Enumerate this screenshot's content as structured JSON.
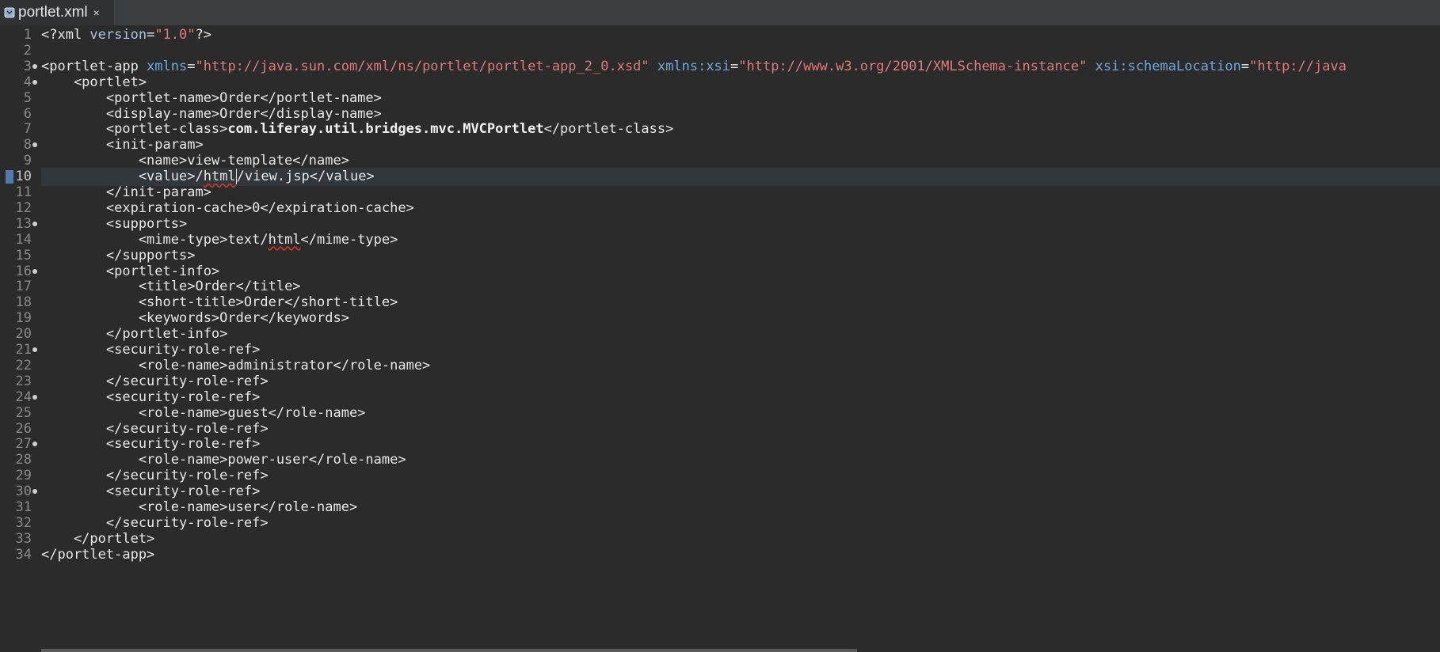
{
  "tab": {
    "title": "portlet.xml",
    "close": "×"
  },
  "editor": {
    "current_line": 10,
    "lines": [
      {
        "n": "1",
        "fold": false,
        "tokens": [
          {
            "t": "<?xml ",
            "c": "tag"
          },
          {
            "t": "version",
            "c": "decl"
          },
          {
            "t": "=",
            "c": "tag"
          },
          {
            "t": "\"1.0\"",
            "c": "str"
          },
          {
            "t": "?>",
            "c": "tag"
          }
        ]
      },
      {
        "n": "2",
        "fold": false,
        "tokens": []
      },
      {
        "n": "3",
        "fold": true,
        "tokens": [
          {
            "t": "<portlet-app ",
            "c": "tag"
          },
          {
            "t": "xmlns",
            "c": "attr"
          },
          {
            "t": "=",
            "c": "tag"
          },
          {
            "t": "\"http://java.sun.com/xml/ns/portlet/portlet-app_2_0.xsd\"",
            "c": "str"
          },
          {
            "t": " ",
            "c": "tag"
          },
          {
            "t": "xmlns:xsi",
            "c": "attr"
          },
          {
            "t": "=",
            "c": "tag"
          },
          {
            "t": "\"http://www.w3.org/2001/XMLSchema-instance\"",
            "c": "str"
          },
          {
            "t": " ",
            "c": "tag"
          },
          {
            "t": "xsi:schemaLocation",
            "c": "attr"
          },
          {
            "t": "=",
            "c": "tag"
          },
          {
            "t": "\"http://java",
            "c": "str"
          }
        ]
      },
      {
        "n": "4",
        "fold": true,
        "tokens": [
          {
            "t": "    <portlet>",
            "c": "tag"
          }
        ]
      },
      {
        "n": "5",
        "fold": false,
        "tokens": [
          {
            "t": "        <portlet-name>",
            "c": "tag"
          },
          {
            "t": "Order",
            "c": "txt"
          },
          {
            "t": "</portlet-name>",
            "c": "tag"
          }
        ]
      },
      {
        "n": "6",
        "fold": false,
        "tokens": [
          {
            "t": "        <display-name>",
            "c": "tag"
          },
          {
            "t": "Order",
            "c": "txt"
          },
          {
            "t": "</display-name>",
            "c": "tag"
          }
        ]
      },
      {
        "n": "7",
        "fold": false,
        "tokens": [
          {
            "t": "        <portlet-class>",
            "c": "tag"
          },
          {
            "t": "com.liferay.util.bridges.mvc.MVCPortlet",
            "c": "bold"
          },
          {
            "t": "</portlet-class>",
            "c": "tag"
          }
        ]
      },
      {
        "n": "8",
        "fold": true,
        "tokens": [
          {
            "t": "        <init-param>",
            "c": "tag"
          }
        ]
      },
      {
        "n": "9",
        "fold": false,
        "tokens": [
          {
            "t": "            <name>",
            "c": "tag"
          },
          {
            "t": "view-template",
            "c": "txt"
          },
          {
            "t": "</name>",
            "c": "tag"
          }
        ]
      },
      {
        "n": "10",
        "fold": false,
        "tokens": [
          {
            "t": "            <value>",
            "c": "tag"
          },
          {
            "t": "/",
            "c": "txt"
          },
          {
            "t": "html",
            "c": "txt",
            "squiggle": true
          },
          {
            "t": "/view.jsp",
            "c": "txt",
            "caret": true
          },
          {
            "t": "</value>",
            "c": "tag"
          }
        ]
      },
      {
        "n": "11",
        "fold": false,
        "tokens": [
          {
            "t": "        </init-param>",
            "c": "tag"
          }
        ]
      },
      {
        "n": "12",
        "fold": false,
        "tokens": [
          {
            "t": "        <expiration-cache>",
            "c": "tag"
          },
          {
            "t": "0",
            "c": "txt"
          },
          {
            "t": "</expiration-cache>",
            "c": "tag"
          }
        ]
      },
      {
        "n": "13",
        "fold": true,
        "tokens": [
          {
            "t": "        <supports>",
            "c": "tag"
          }
        ]
      },
      {
        "n": "14",
        "fold": false,
        "tokens": [
          {
            "t": "            <mime-type>",
            "c": "tag"
          },
          {
            "t": "text/",
            "c": "txt"
          },
          {
            "t": "html",
            "c": "txt",
            "squiggle": true
          },
          {
            "t": "</mime-type>",
            "c": "tag"
          }
        ]
      },
      {
        "n": "15",
        "fold": false,
        "tokens": [
          {
            "t": "        </supports>",
            "c": "tag"
          }
        ]
      },
      {
        "n": "16",
        "fold": true,
        "tokens": [
          {
            "t": "        <portlet-info>",
            "c": "tag"
          }
        ]
      },
      {
        "n": "17",
        "fold": false,
        "tokens": [
          {
            "t": "            <title>",
            "c": "tag"
          },
          {
            "t": "Order",
            "c": "txt"
          },
          {
            "t": "</title>",
            "c": "tag"
          }
        ]
      },
      {
        "n": "18",
        "fold": false,
        "tokens": [
          {
            "t": "            <short-title>",
            "c": "tag"
          },
          {
            "t": "Order",
            "c": "txt"
          },
          {
            "t": "</short-title>",
            "c": "tag"
          }
        ]
      },
      {
        "n": "19",
        "fold": false,
        "tokens": [
          {
            "t": "            <keywords>",
            "c": "tag"
          },
          {
            "t": "Order",
            "c": "txt"
          },
          {
            "t": "</keywords>",
            "c": "tag"
          }
        ]
      },
      {
        "n": "20",
        "fold": false,
        "tokens": [
          {
            "t": "        </portlet-info>",
            "c": "tag"
          }
        ]
      },
      {
        "n": "21",
        "fold": true,
        "tokens": [
          {
            "t": "        <security-role-ref>",
            "c": "tag"
          }
        ]
      },
      {
        "n": "22",
        "fold": false,
        "tokens": [
          {
            "t": "            <role-name>",
            "c": "tag"
          },
          {
            "t": "administrator",
            "c": "txt"
          },
          {
            "t": "</role-name>",
            "c": "tag"
          }
        ]
      },
      {
        "n": "23",
        "fold": false,
        "tokens": [
          {
            "t": "        </security-role-ref>",
            "c": "tag"
          }
        ]
      },
      {
        "n": "24",
        "fold": true,
        "tokens": [
          {
            "t": "        <security-role-ref>",
            "c": "tag"
          }
        ]
      },
      {
        "n": "25",
        "fold": false,
        "tokens": [
          {
            "t": "            <role-name>",
            "c": "tag"
          },
          {
            "t": "guest",
            "c": "txt"
          },
          {
            "t": "</role-name>",
            "c": "tag"
          }
        ]
      },
      {
        "n": "26",
        "fold": false,
        "tokens": [
          {
            "t": "        </security-role-ref>",
            "c": "tag"
          }
        ]
      },
      {
        "n": "27",
        "fold": true,
        "tokens": [
          {
            "t": "        <security-role-ref>",
            "c": "tag"
          }
        ]
      },
      {
        "n": "28",
        "fold": false,
        "tokens": [
          {
            "t": "            <role-name>",
            "c": "tag"
          },
          {
            "t": "power-user",
            "c": "txt"
          },
          {
            "t": "</role-name>",
            "c": "tag"
          }
        ]
      },
      {
        "n": "29",
        "fold": false,
        "tokens": [
          {
            "t": "        </security-role-ref>",
            "c": "tag"
          }
        ]
      },
      {
        "n": "30",
        "fold": true,
        "tokens": [
          {
            "t": "        <security-role-ref>",
            "c": "tag"
          }
        ]
      },
      {
        "n": "31",
        "fold": false,
        "tokens": [
          {
            "t": "            <role-name>",
            "c": "tag"
          },
          {
            "t": "user",
            "c": "txt"
          },
          {
            "t": "</role-name>",
            "c": "tag"
          }
        ]
      },
      {
        "n": "32",
        "fold": false,
        "tokens": [
          {
            "t": "        </security-role-ref>",
            "c": "tag"
          }
        ]
      },
      {
        "n": "33",
        "fold": false,
        "tokens": [
          {
            "t": "    </portlet>",
            "c": "tag"
          }
        ]
      },
      {
        "n": "34",
        "fold": false,
        "tokens": [
          {
            "t": "</portlet-app>",
            "c": "tag"
          }
        ]
      }
    ]
  },
  "colors": {
    "background": "#2b2b2b",
    "tag": "#e8e8e8",
    "attribute": "#6fa8dc",
    "string": "#e07a7a",
    "current_line": "#32373b"
  }
}
